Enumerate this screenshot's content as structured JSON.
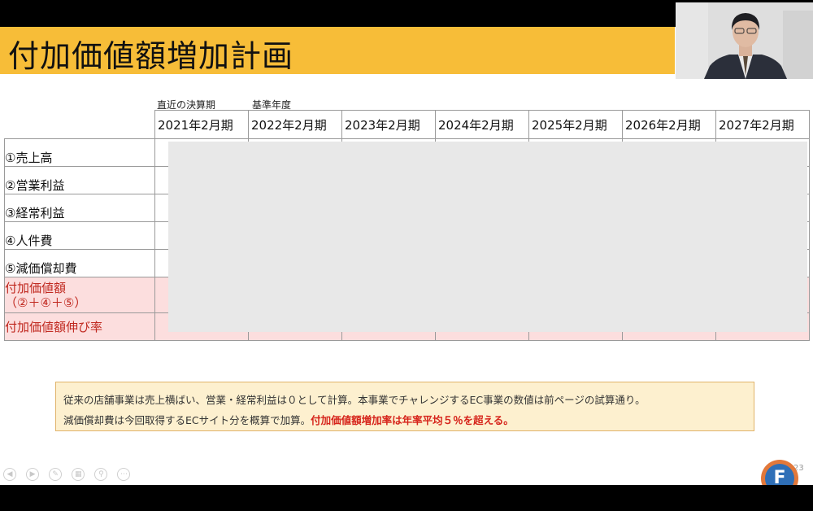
{
  "slide": {
    "title": "付加価値額増加計画",
    "col_captions": {
      "recent": "直近の決算期",
      "base": "基準年度"
    },
    "periods": [
      "2021年2月期",
      "2022年2月期",
      "2023年2月期",
      "2024年2月期",
      "2025年2月期",
      "2026年2月期",
      "2027年2月期"
    ],
    "rows": [
      {
        "label": "①売上高"
      },
      {
        "label": "②営業利益"
      },
      {
        "label": "③経常利益"
      },
      {
        "label": "④人件費"
      },
      {
        "label": "⑤減価償却費"
      },
      {
        "label": "付加価値額",
        "label2": "（②＋④＋⑤）"
      },
      {
        "label": "付加価値額伸び率"
      }
    ],
    "note": {
      "line1": "従来の店舗事業は売上横ばい、営業・経常利益は０として計算。本事業でチャレンジするEC事業の数値は前ページの試算通り。",
      "line2_plain": "減価償却費は今回取得するECサイト分を概算で加算。",
      "line2_highlight": "付加価値額増加率は年率平均５％を超える。"
    },
    "page_number": "23"
  },
  "logo": {
    "letter": "F"
  },
  "colors": {
    "title_band": "#f7bd38",
    "pink_row": "#fcdede",
    "accent_red": "#c0281f",
    "note_bg": "#fdf0cf"
  },
  "icons": [
    "prev-icon",
    "next-icon",
    "pen-icon",
    "pages-icon",
    "zoom-icon",
    "more-icon"
  ]
}
